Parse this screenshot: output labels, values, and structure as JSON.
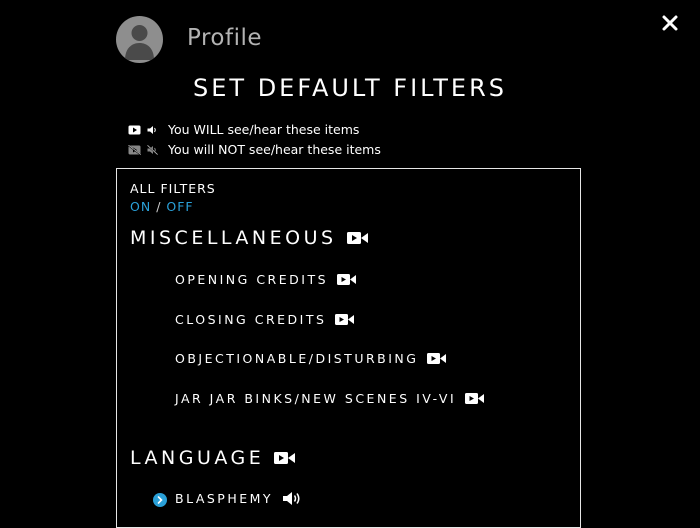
{
  "header": {
    "profile_title": "Profile"
  },
  "title": "SET DEFAULT FILTERS",
  "legend": {
    "see": "You WILL see/hear these items",
    "not_see": "You will NOT see/hear these items"
  },
  "filters": {
    "all_label": "ALL FILTERS",
    "on": "ON",
    "separator": "/",
    "off": "OFF"
  },
  "categories": [
    {
      "name": "MISCELLANEOUS",
      "icon": "video-camera-icon",
      "items": [
        {
          "label": "OPENING CREDITS",
          "icon": "video-camera-icon"
        },
        {
          "label": "CLOSING CREDITS",
          "icon": "video-camera-icon"
        },
        {
          "label": "OBJECTIONABLE/DISTURBING",
          "icon": "video-camera-icon"
        },
        {
          "label": "JAR JAR BINKS/NEW SCENES IV-VI",
          "icon": "video-camera-icon"
        }
      ]
    },
    {
      "name": "LANGUAGE",
      "icon": "video-camera-icon",
      "items": [
        {
          "label": "BLASPHEMY",
          "icon": "speaker-icon"
        }
      ]
    }
  ],
  "colors": {
    "accent": "#2aa0d8",
    "background": "#000000",
    "muted": "#b3b3b3"
  }
}
